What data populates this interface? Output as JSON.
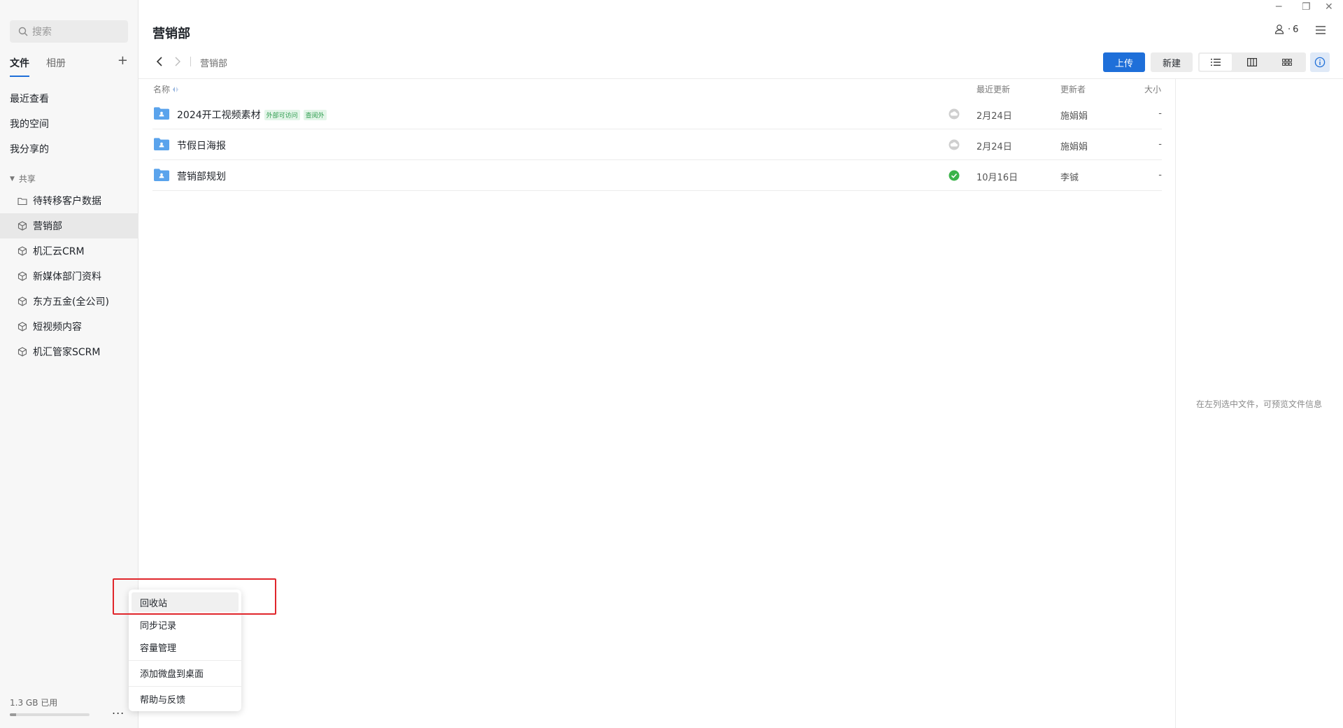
{
  "sidebar": {
    "search_placeholder": "搜索",
    "tabs": [
      {
        "label": "文件"
      },
      {
        "label": "相册"
      }
    ],
    "add_label": "+",
    "nav": [
      {
        "label": "最近查看"
      },
      {
        "label": "我的空间"
      },
      {
        "label": "我分享的"
      }
    ],
    "shared_section": "共享",
    "shared_items": [
      {
        "label": "待转移客户数据"
      },
      {
        "label": "营销部"
      },
      {
        "label": "机汇云CRM"
      },
      {
        "label": "新媒体部门资料"
      },
      {
        "label": "东方五金(全公司)"
      },
      {
        "label": "短视频内容"
      },
      {
        "label": "机汇管家SCRM"
      }
    ],
    "storage_used": "1.3 GB 已用",
    "storage_fraction": 0.08,
    "more_label": "..."
  },
  "header": {
    "title": "营销部",
    "member_count": "6",
    "breadcrumb": "营销部",
    "upload_label": "上传",
    "new_label": "新建"
  },
  "columns": {
    "name": "名称",
    "updated": "最近更新",
    "updater": "更新者",
    "size": "大小"
  },
  "files": [
    {
      "name": "2024开工视频素材",
      "tags": [
        "外部可访问",
        "查阅外"
      ],
      "status": "cloud",
      "date": "2月24日",
      "updater": "施娟娟",
      "size": "-"
    },
    {
      "name": "节假日海报",
      "tags": [],
      "status": "cloud",
      "date": "2月24日",
      "updater": "施娟娟",
      "size": "-"
    },
    {
      "name": "营销部规划",
      "tags": [],
      "status": "synced",
      "date": "10月16日",
      "updater": "李铖",
      "size": "-"
    }
  ],
  "detail_hint": "在左列选中文件，可预览文件信息",
  "menu": {
    "items": [
      {
        "label": "回收站"
      },
      {
        "label": "同步记录"
      },
      {
        "label": "容量管理"
      },
      {
        "label": "添加微盘到桌面"
      },
      {
        "label": "帮助与反馈"
      }
    ]
  },
  "colors": {
    "accent": "#1e6fd9",
    "folder": "#5aa3ec",
    "synced": "#3bb34a",
    "highlight": "#e0262b"
  }
}
